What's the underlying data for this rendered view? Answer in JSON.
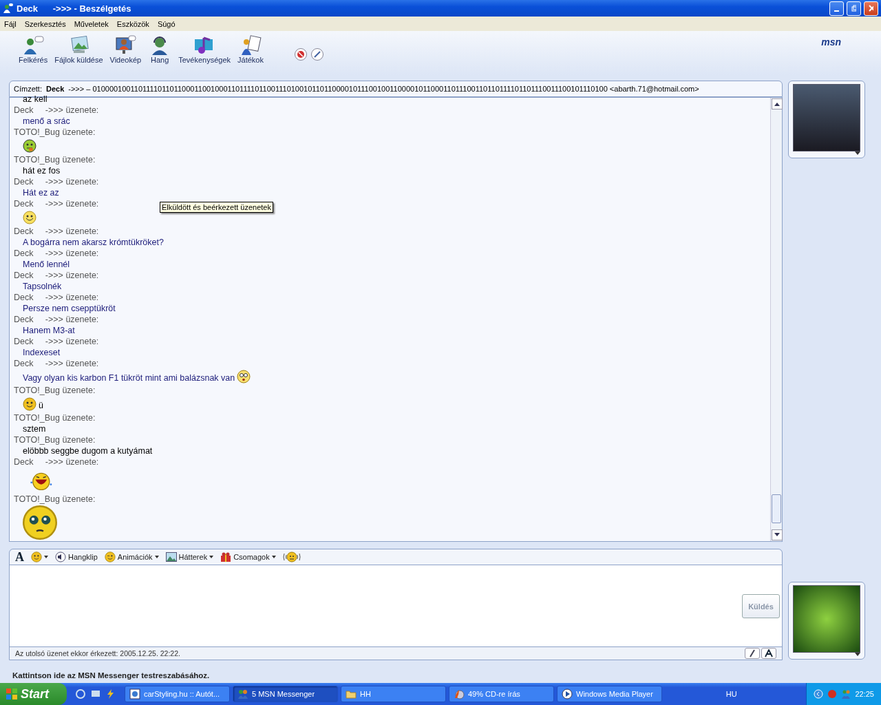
{
  "window": {
    "title": "Deck      ->>> - Beszélgetés"
  },
  "menu": [
    "Fájl",
    "Szerkesztés",
    "Műveletek",
    "Eszközök",
    "Súgó"
  ],
  "toolbar": [
    {
      "kind": "invite",
      "label": "Felkérés"
    },
    {
      "kind": "files",
      "label": "Fájlok küldése"
    },
    {
      "kind": "video",
      "label": "Videokép"
    },
    {
      "kind": "voice",
      "label": "Hang"
    },
    {
      "kind": "activities",
      "label": "Tevékenységek"
    },
    {
      "kind": "games",
      "label": "Játékok"
    }
  ],
  "brand": "msn",
  "recipient": {
    "label": "Címzett:",
    "name": "Deck",
    "address": "->>> – 0100001001101111011011000110010001101111011001110100101101100001011100100110000101100011011100110110111101101110011100101110100 <abarth.71@hotmail.com>"
  },
  "messages": [
    {
      "color": "#000000",
      "parts": [
        {
          "kind": "text",
          "text": "az kell"
        }
      ]
    },
    {
      "header": "Deck     ->>> üzenete:",
      "color": "#1c1c7a",
      "parts": [
        {
          "kind": "text",
          "text": "menő a srác"
        }
      ]
    },
    {
      "header": "TOTO!_Bug üzenete:",
      "parts": [
        {
          "kind": "tongue"
        }
      ]
    },
    {
      "header": "TOTO!_Bug üzenete:",
      "color": "#000000",
      "parts": [
        {
          "kind": "text",
          "text": "hát ez fos"
        }
      ]
    },
    {
      "header": "Deck     ->>> üzenete:",
      "color": "#1c1c7a",
      "parts": [
        {
          "kind": "text",
          "text": "Hát ez az"
        }
      ]
    },
    {
      "header": "Deck     ->>> üzenete:",
      "parts": [
        {
          "kind": "grin"
        }
      ]
    },
    {
      "header": "Deck     ->>> üzenete:",
      "color": "#1c1c7a",
      "parts": [
        {
          "kind": "text",
          "text": "A bogárra nem akarsz krómtükröket?"
        }
      ]
    },
    {
      "header": "Deck     ->>> üzenete:",
      "color": "#1c1c7a",
      "parts": [
        {
          "kind": "text",
          "text": "Menő lennél"
        }
      ]
    },
    {
      "header": "Deck     ->>> üzenete:",
      "color": "#1c1c7a",
      "parts": [
        {
          "kind": "text",
          "text": "Tapsolnék"
        }
      ]
    },
    {
      "header": "Deck     ->>> üzenete:",
      "color": "#1c1c7a",
      "parts": [
        {
          "kind": "text",
          "text": "Persze nem csepptükröt"
        }
      ]
    },
    {
      "header": "Deck     ->>> üzenete:",
      "color": "#1c1c7a",
      "parts": [
        {
          "kind": "text",
          "text": "Hanem M3-at"
        }
      ]
    },
    {
      "header": "Deck     ->>> üzenete:",
      "color": "#1c1c7a",
      "parts": [
        {
          "kind": "text",
          "text": "Indexeset"
        }
      ]
    },
    {
      "header": "Deck     ->>> üzenete:",
      "color": "#1c1c7a",
      "parts": [
        {
          "kind": "text",
          "text": "Vagy olyan kis karbon F1 tükröt mint ami balázsnak van"
        },
        {
          "kind": "surprised"
        }
      ]
    },
    {
      "header": "TOTO!_Bug üzenete:",
      "color": "#000000",
      "parts": [
        {
          "kind": "smile"
        },
        {
          "kind": "text",
          "text": "ü"
        }
      ]
    },
    {
      "header": "TOTO!_Bug üzenete:",
      "color": "#000000",
      "parts": [
        {
          "kind": "text",
          "text": "sztem"
        }
      ]
    },
    {
      "header": "TOTO!_Bug üzenete:",
      "color": "#000000",
      "parts": [
        {
          "kind": "text",
          "text": "elöbbb seggbe dugom a kutyámat"
        }
      ]
    },
    {
      "header": "Deck     ->>> üzenete:",
      "parts": [
        {
          "kind": "laughing"
        }
      ]
    },
    {
      "header": "TOTO!_Bug üzenete:",
      "parts": [
        {
          "kind": "crying"
        }
      ]
    }
  ],
  "tooltip": "Elküldött és beérkezett üzenetek",
  "input_toolbar": [
    {
      "kind": "font",
      "label": "A"
    },
    {
      "kind": "emoticons",
      "dropdown": true
    },
    {
      "kind": "voiceclip",
      "label": "Hangklip",
      "dropdown": false
    },
    {
      "kind": "winks",
      "label": "Animációk",
      "dropdown": true
    },
    {
      "kind": "backgrounds",
      "label": "Hátterek",
      "dropdown": true
    },
    {
      "kind": "packs",
      "label": "Csomagok",
      "dropdown": true
    },
    {
      "kind": "nudge",
      "dropdown": false
    }
  ],
  "send_button": "Küldés",
  "last_message": "Az utolsó üzenet ekkor érkezett: 2005.12.25. 22:22.",
  "status_bar": "Kattintson ide az MSN Messenger testreszabásához.",
  "taskbar": {
    "start": "Start",
    "tasks": [
      {
        "kind": "browser",
        "label": "carStyling.hu :: Autót...",
        "selected": false
      },
      {
        "kind": "messenger",
        "label": "5 MSN Messenger",
        "selected": true
      },
      {
        "kind": "folder",
        "label": "HH",
        "selected": false
      },
      {
        "kind": "burn",
        "label": "49% CD-re írás",
        "selected": false
      },
      {
        "kind": "player",
        "label": "Windows Media Player",
        "selected": false
      }
    ],
    "language": "HU",
    "clock": "22:25"
  }
}
